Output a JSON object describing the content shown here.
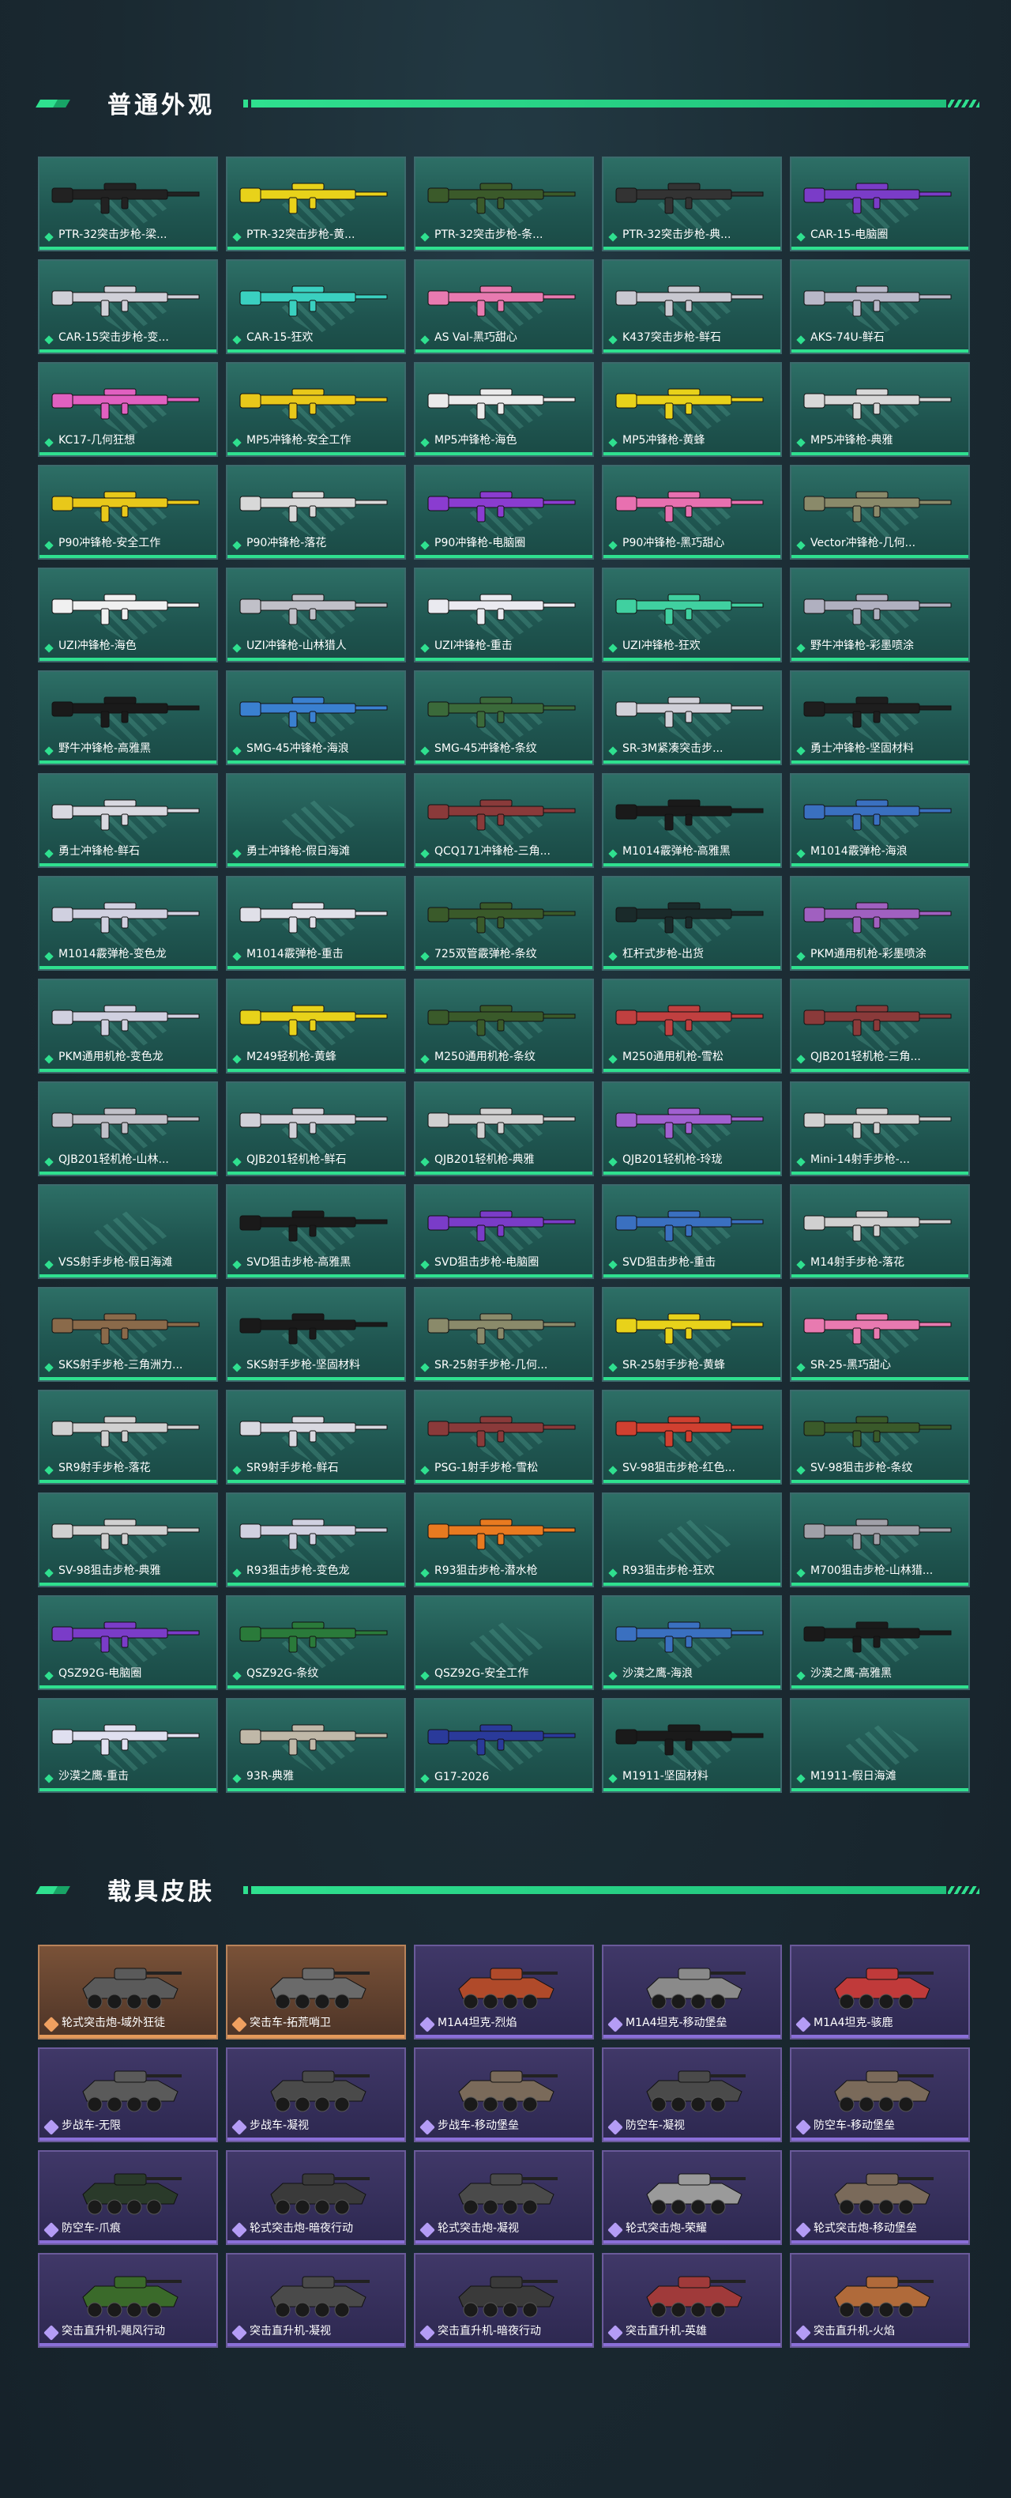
{
  "sections": {
    "weapons_title": "普通外观",
    "vehicles_title": "载具皮肤"
  },
  "colors": {
    "accent": "#2fe08f",
    "weapon_card": "#1f5550",
    "vehicle_card_purple": "#403868",
    "vehicle_card_orange": "#7a5238"
  },
  "weapons": [
    {
      "label": "PTR-32突击步枪-梁...",
      "color": "#222222"
    },
    {
      "label": "PTR-32突击步枪-黄...",
      "color": "#e8d21a"
    },
    {
      "label": "PTR-32突击步枪-条...",
      "color": "#3b5a2a"
    },
    {
      "label": "PTR-32突击步枪-典...",
      "color": "#333333"
    },
    {
      "label": "CAR-15-电脑圈",
      "color": "#7a3cc8"
    },
    {
      "label": "CAR-15突击步枪-变...",
      "color": "#d0d0d8"
    },
    {
      "label": "CAR-15-狂欢",
      "color": "#3ad0c0"
    },
    {
      "label": "AS Val-黑巧甜心",
      "color": "#e87ab0"
    },
    {
      "label": "K437突击步枪-鲜石",
      "color": "#c8c8d0"
    },
    {
      "label": "AKS-74U-鲜石",
      "color": "#b8b8c8"
    },
    {
      "label": "KC17-几何狂想",
      "color": "#e060c0"
    },
    {
      "label": "MP5冲锋枪-安全工作",
      "color": "#e8c81a"
    },
    {
      "label": "MP5冲锋枪-海色",
      "color": "#eaeaea"
    },
    {
      "label": "MP5冲锋枪-黄蜂",
      "color": "#e8d21a"
    },
    {
      "label": "MP5冲锋枪-典雅",
      "color": "#d8d8d8"
    },
    {
      "label": "P90冲锋枪-安全工作",
      "color": "#e8c81a"
    },
    {
      "label": "P90冲锋枪-落花",
      "color": "#d8d8d8"
    },
    {
      "label": "P90冲锋枪-电脑圈",
      "color": "#8a3cd0"
    },
    {
      "label": "P90冲锋枪-黑巧甜心",
      "color": "#e870b0"
    },
    {
      "label": "Vector冲锋枪-几何...",
      "color": "#8a8a6a"
    },
    {
      "label": "UZI冲锋枪-海色",
      "color": "#f0f0f0"
    },
    {
      "label": "UZI冲锋枪-山林猎人",
      "color": "#c0c0c8"
    },
    {
      "label": "UZI冲锋枪-重击",
      "color": "#eaeaf0"
    },
    {
      "label": "UZI冲锋枪-狂欢",
      "color": "#40d0a0"
    },
    {
      "label": "野牛冲锋枪-彩墨喷涂",
      "color": "#b0b0c0"
    },
    {
      "label": "野牛冲锋枪-高雅黑",
      "color": "#1a1a1a"
    },
    {
      "label": "SMG-45冲锋枪-海浪",
      "color": "#3a80d0"
    },
    {
      "label": "SMG-45冲锋枪-条纹",
      "color": "#3b6a3a"
    },
    {
      "label": "SR-3M紧凑突击步...",
      "color": "#d0d0d8"
    },
    {
      "label": "勇士冲锋枪-坚固材料",
      "color": "#1e1e1e"
    },
    {
      "label": "勇士冲锋枪-鲜石",
      "color": "#d8d8e0"
    },
    {
      "label": "勇士冲锋枪-假日海滩",
      "color": ""
    },
    {
      "label": "QCQ171冲锋枪-三角...",
      "color": "#8a3a3a"
    },
    {
      "label": "M1014霰弹枪-高雅黑",
      "color": "#1a1a1a"
    },
    {
      "label": "M1014霰弹枪-海浪",
      "color": "#3a70c0"
    },
    {
      "label": "M1014霰弹枪-变色龙",
      "color": "#d0d0e0"
    },
    {
      "label": "M1014霰弹枪-重击",
      "color": "#e0e0e8"
    },
    {
      "label": "725双管霰弹枪-条纹",
      "color": "#3a5a2a"
    },
    {
      "label": "杠杆式步枪-出货",
      "color": "#1a2a2a"
    },
    {
      "label": "PKM通用机枪-彩墨喷涂",
      "color": "#a060c0"
    },
    {
      "label": "PKM通用机枪-变色龙",
      "color": "#d0d0e0"
    },
    {
      "label": "M249轻机枪-黄蜂",
      "color": "#e8d21a"
    },
    {
      "label": "M250通用机枪-条纹",
      "color": "#3a5a2a"
    },
    {
      "label": "M250通用机枪-雪松",
      "color": "#c04040"
    },
    {
      "label": "QJB201轻机枪-三角...",
      "color": "#8a3a3a"
    },
    {
      "label": "QJB201轻机枪-山林...",
      "color": "#c0c0c8"
    },
    {
      "label": "QJB201轻机枪-鲜石",
      "color": "#d0d0d8"
    },
    {
      "label": "QJB201轻机枪-典雅",
      "color": "#d0d0d0"
    },
    {
      "label": "QJB201轻机枪-玲珑",
      "color": "#a060d0"
    },
    {
      "label": "Mini-14射手步枪-...",
      "color": "#d0d0d0"
    },
    {
      "label": "VSS射手步枪-假日海滩",
      "color": ""
    },
    {
      "label": "SVD狙击步枪-高雅黑",
      "color": "#1a1a1a"
    },
    {
      "label": "SVD狙击步枪-电脑圈",
      "color": "#7a3cc8"
    },
    {
      "label": "SVD狙击步枪-重击",
      "color": "#3a70c0"
    },
    {
      "label": "M14射手步枪-落花",
      "color": "#d0d0d0"
    },
    {
      "label": "SKS射手步枪-三角洲力...",
      "color": "#8a6a4a"
    },
    {
      "label": "SKS射手步枪-坚固材料",
      "color": "#1a1a1a"
    },
    {
      "label": "SR-25射手步枪-几何...",
      "color": "#8a8a6a"
    },
    {
      "label": "SR-25射手步枪-黄蜂",
      "color": "#e8d21a"
    },
    {
      "label": "SR-25-黑巧甜心",
      "color": "#e87ab0"
    },
    {
      "label": "SR9射手步枪-落花",
      "color": "#d0d0d0"
    },
    {
      "label": "SR9射手步枪-鲜石",
      "color": "#d8d8e0"
    },
    {
      "label": "PSG-1射手步枪-雪松",
      "color": "#8a3a3a"
    },
    {
      "label": "SV-98狙击步枪-红色...",
      "color": "#d04030"
    },
    {
      "label": "SV-98狙击步枪-条纹",
      "color": "#3a5a2a"
    },
    {
      "label": "SV-98狙击步枪-典雅",
      "color": "#d0d0d0"
    },
    {
      "label": "R93狙击步枪-变色龙",
      "color": "#d0d0e0"
    },
    {
      "label": "R93狙击步枪-潜水枪",
      "color": "#e87a20"
    },
    {
      "label": "R93狙击步枪-狂欢",
      "color": ""
    },
    {
      "label": "M700狙击步枪-山林猎...",
      "color": "#a0a0a8"
    },
    {
      "label": "QSZ92G-电脑圈",
      "color": "#7a3cc8"
    },
    {
      "label": "QSZ92G-条纹",
      "color": "#2a7a3a"
    },
    {
      "label": "QSZ92G-安全工作",
      "color": ""
    },
    {
      "label": "沙漠之鹰-海浪",
      "color": "#3a70c0"
    },
    {
      "label": "沙漠之鹰-高雅黑",
      "color": "#1a1a1a"
    },
    {
      "label": "沙漠之鹰-重击",
      "color": "#e0e0f0"
    },
    {
      "label": "93R-典雅",
      "color": "#c0b8a8"
    },
    {
      "label": "G17-2026",
      "color": "#2a3a9a"
    },
    {
      "label": "M1911-坚固材料",
      "color": "#1a1a1a"
    },
    {
      "label": "M1911-假日海滩",
      "color": ""
    }
  ],
  "vehicles": [
    {
      "label": "轮式突击炮-域外狂徒",
      "color": "#5a5a5a",
      "theme": "orange"
    },
    {
      "label": "突击车-拓荒哨卫",
      "color": "#6a6a6a",
      "theme": "orange"
    },
    {
      "label": "M1A4坦克-烈焰",
      "color": "#b04a2a",
      "theme": "purple"
    },
    {
      "label": "M1A4坦克-移动堡垒",
      "color": "#8a8a8a",
      "theme": "purple"
    },
    {
      "label": "M1A4坦克-骇鹿",
      "color": "#c03a3a",
      "theme": "purple"
    },
    {
      "label": "步战车-无限",
      "color": "#5a5a5a",
      "theme": "purple"
    },
    {
      "label": "步战车-凝视",
      "color": "#4a4a4a",
      "theme": "purple"
    },
    {
      "label": "步战车-移动堡垒",
      "color": "#7a6a5a",
      "theme": "purple"
    },
    {
      "label": "防空车-凝视",
      "color": "#4a4a4a",
      "theme": "purple"
    },
    {
      "label": "防空车-移动堡垒",
      "color": "#7a6a5a",
      "theme": "purple"
    },
    {
      "label": "防空车-爪痕",
      "color": "#2a3a2a",
      "theme": "purple"
    },
    {
      "label": "轮式突击炮-暗夜行动",
      "color": "#3a3a3a",
      "theme": "purple"
    },
    {
      "label": "轮式突击炮-凝视",
      "color": "#4a4a4a",
      "theme": "purple"
    },
    {
      "label": "轮式突击炮-荣耀",
      "color": "#9a9a9a",
      "theme": "purple"
    },
    {
      "label": "轮式突击炮-移动堡垒",
      "color": "#7a6a5a",
      "theme": "purple"
    },
    {
      "label": "突击直升机-飓风行动",
      "color": "#3a6a2a",
      "theme": "purple"
    },
    {
      "label": "突击直升机-凝视",
      "color": "#4a4a4a",
      "theme": "purple"
    },
    {
      "label": "突击直升机-暗夜行动",
      "color": "#3a3a3a",
      "theme": "purple"
    },
    {
      "label": "突击直升机-英雄",
      "color": "#a03a3a",
      "theme": "purple"
    },
    {
      "label": "突击直升机-火焰",
      "color": "#b06a3a",
      "theme": "purple"
    }
  ]
}
